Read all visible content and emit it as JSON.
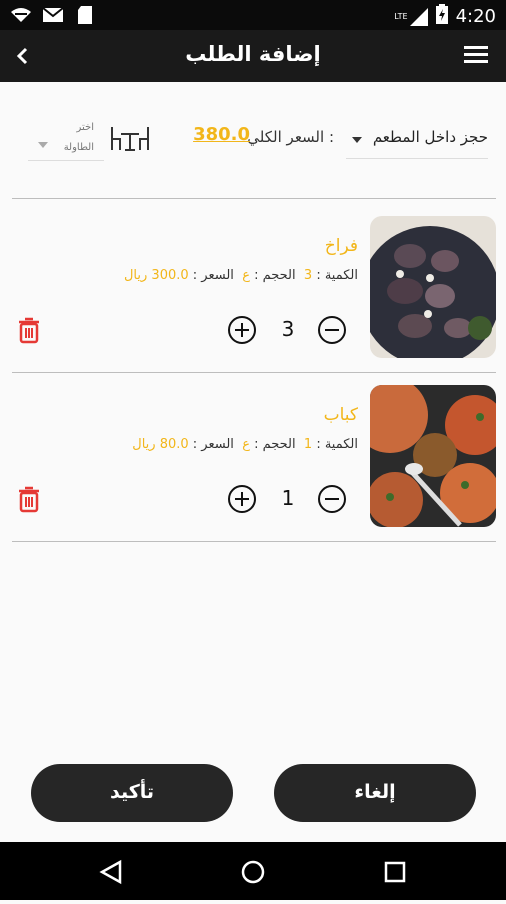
{
  "status_bar": {
    "network": "LTE",
    "time": "4:20"
  },
  "app_bar": {
    "title": "إضافة الطلب"
  },
  "order_header": {
    "dine_in_label": "حجز داخل المطعم",
    "total_label": "السعر الكلي :",
    "total_value": "380.0",
    "table_select_line1": "اختر",
    "table_select_line2": "الطاولة"
  },
  "items": [
    {
      "name": "فراخ",
      "quantity_label": "الكمية :",
      "quantity_value": "3",
      "size_label": "الحجم :",
      "size_value": "ع",
      "price_label": "السعر :",
      "price_value": "300.0 ريال",
      "stepper_value": "3"
    },
    {
      "name": "كباب",
      "quantity_label": "الكمية :",
      "quantity_value": "1",
      "size_label": "الحجم :",
      "size_value": "ع",
      "price_label": "السعر :",
      "price_value": "80.0 ريال",
      "stepper_value": "1"
    }
  ],
  "actions": {
    "confirm_label": "تأكيد",
    "cancel_label": "إلغاء"
  },
  "colors": {
    "accent": "#f2b61a",
    "bar": "#1a1a1a",
    "delete": "#e53935"
  },
  "icons": [
    "wifi-icon",
    "mail-icon",
    "sd-card-icon",
    "lte-icon",
    "battery-icon",
    "back-icon",
    "menu-icon",
    "table-icon",
    "plus-icon",
    "minus-icon",
    "trash-icon",
    "nav-back-icon",
    "nav-home-icon",
    "nav-recents-icon"
  ]
}
